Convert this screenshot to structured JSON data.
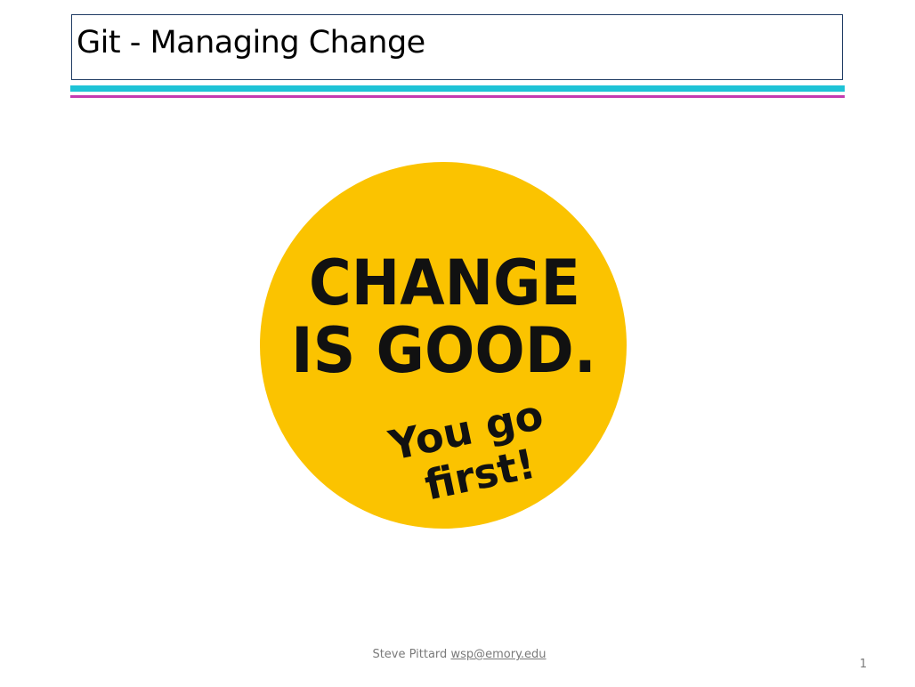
{
  "slide": {
    "title": "Git - Managing Change",
    "badge": {
      "line1": "CHANGE",
      "line2": "IS GOOD.",
      "line3": "You go",
      "line4": "first!",
      "fill_color": "#fbc300",
      "text_color": "#111111"
    },
    "footer": {
      "author": "Steve Pittard",
      "email": "wsp@emory.edu"
    },
    "page_number": "1",
    "colors": {
      "title_border": "#1f3b63",
      "rule_top": "#1ec3d6",
      "rule_bottom": "#c43bb0"
    }
  }
}
